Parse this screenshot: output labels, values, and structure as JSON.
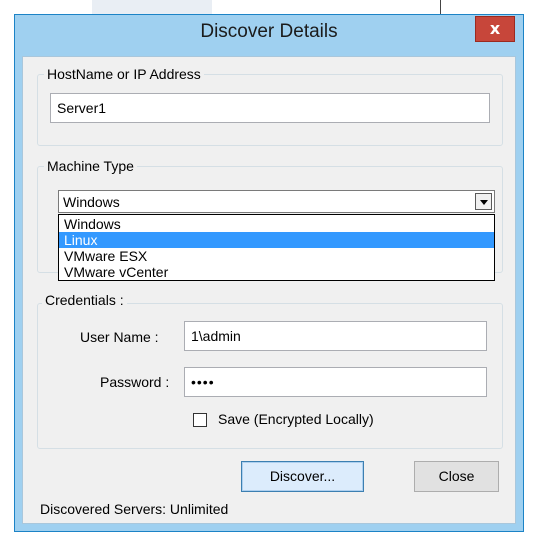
{
  "dialog": {
    "title": "Discover Details",
    "close_glyph": "x"
  },
  "host_group": {
    "label": "HostName or IP Address",
    "value": "Server1"
  },
  "machine_group": {
    "label": "Machine Type",
    "selected": "Windows",
    "options": [
      "Windows",
      "Linux",
      "VMware ESX",
      "VMware vCenter"
    ],
    "highlighted": "Linux"
  },
  "credentials": {
    "label": "Credentials :",
    "username_label": "User Name :",
    "username_value": "1\\admin",
    "password_label": "Password :",
    "password_value": "••••",
    "save_label": "Save (Encrypted Locally)",
    "save_checked": false
  },
  "buttons": {
    "discover": "Discover...",
    "close": "Close"
  },
  "status": "Discovered Servers: Unlimited",
  "colors": {
    "frame": "#9fd0f0",
    "close_button": "#c7463a",
    "selection": "#3399ff"
  }
}
